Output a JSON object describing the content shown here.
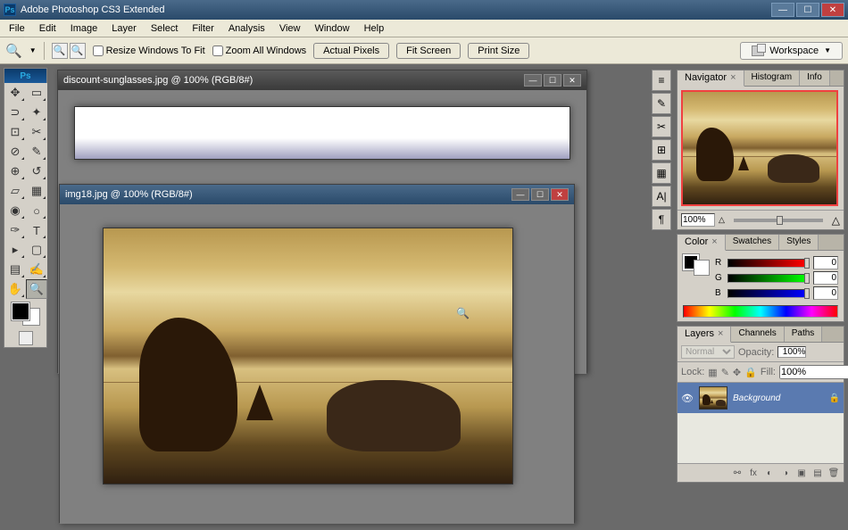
{
  "app": {
    "title": "Adobe Photoshop CS3 Extended"
  },
  "menubar": [
    "File",
    "Edit",
    "Image",
    "Layer",
    "Select",
    "Filter",
    "Analysis",
    "View",
    "Window",
    "Help"
  ],
  "optionsbar": {
    "resize_windows": "Resize Windows To Fit",
    "zoom_all": "Zoom All Windows",
    "actual_pixels": "Actual Pixels",
    "fit_screen": "Fit Screen",
    "print_size": "Print Size",
    "workspace": "Workspace"
  },
  "documents": {
    "doc1": {
      "title": "discount-sunglasses.jpg @ 100% (RGB/8#)"
    },
    "doc2": {
      "title": "img18.jpg @ 100% (RGB/8#)"
    }
  },
  "navigator": {
    "tabs": [
      "Navigator",
      "Histogram",
      "Info"
    ],
    "zoom": "100%"
  },
  "color": {
    "tabs": [
      "Color",
      "Swatches",
      "Styles"
    ],
    "r": "0",
    "g": "0",
    "b": "0",
    "r_label": "R",
    "g_label": "G",
    "b_label": "B"
  },
  "layers": {
    "tabs": [
      "Layers",
      "Channels",
      "Paths"
    ],
    "blend_mode": "Normal",
    "opacity_label": "Opacity:",
    "opacity": "100%",
    "lock_label": "Lock:",
    "fill_label": "Fill:",
    "fill": "100%",
    "layer0": "Background"
  }
}
